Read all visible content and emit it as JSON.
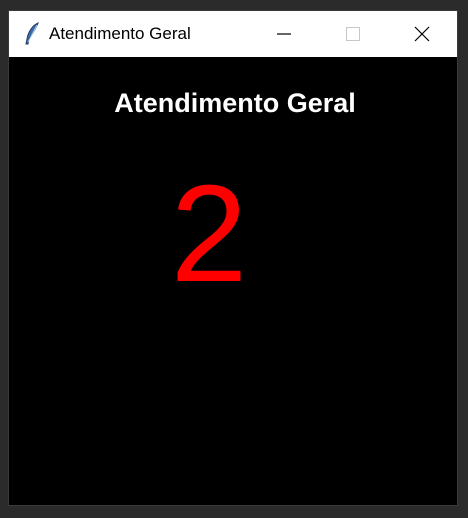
{
  "window": {
    "title": "Atendimento Geral",
    "icon": "feather-icon",
    "controls": [
      "minimize-icon",
      "maximize-icon",
      "close-icon"
    ]
  },
  "main": {
    "heading": "Atendimento Geral",
    "current_number": "2"
  },
  "colors": {
    "background": "#000000",
    "heading": "#ffffff",
    "number": "#ff0000",
    "titlebar": "#ffffff"
  }
}
